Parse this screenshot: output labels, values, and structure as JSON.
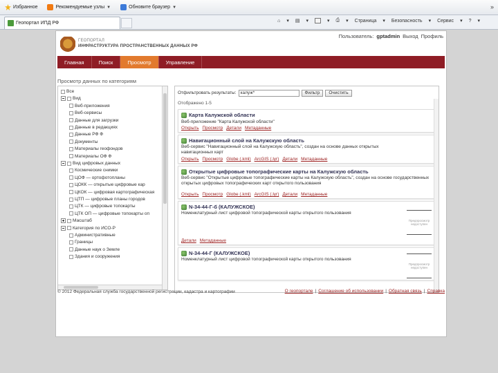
{
  "browser": {
    "bookmarks": [
      {
        "label": "Избранное",
        "icon": "star-icon"
      },
      {
        "label": "Рекомендуемые узлы",
        "icon": "suggested-sites-icon"
      },
      {
        "label": "Обновите браузер",
        "icon": "update-browser-icon"
      }
    ],
    "overflow": "»",
    "tab_title": "Геопортал ИПД РФ",
    "commands": {
      "page": "Страница",
      "safety": "Безопасность",
      "tools": "Сервис",
      "help": "?"
    }
  },
  "header": {
    "logo_line1": "ГЕОПОРТАЛ",
    "logo_line2": "ИНФРАСТРУКТУРА ПРОСТРАНСТВЕННЫХ ДАННЫХ РФ",
    "user_prefix": "Пользователь:",
    "user_name": "gptadmin",
    "logout": "Выход",
    "profile": "Профиль"
  },
  "nav": {
    "items": [
      "Главная",
      "Поиск",
      "Просмотр",
      "Управление"
    ],
    "active_index": 2
  },
  "breadcrumb": "Просмотр данных по категориям",
  "tree": [
    {
      "label": "Все",
      "level": 0,
      "toggle": "none"
    },
    {
      "label": "Вид",
      "level": 0,
      "toggle": "minus"
    },
    {
      "label": "Веб-приложения",
      "level": 1
    },
    {
      "label": "Веб-сервисы",
      "level": 1
    },
    {
      "label": "Данные для загрузки",
      "level": 1
    },
    {
      "label": "Данные в редакциях",
      "level": 1
    },
    {
      "label": "Данные РФ Ф",
      "level": 1
    },
    {
      "label": "Документы",
      "level": 1
    },
    {
      "label": "Материалы геофондов",
      "level": 1
    },
    {
      "label": "Материалы ОФ Ф",
      "level": 1
    },
    {
      "label": "Вид цифровых данных",
      "level": 0,
      "toggle": "minus"
    },
    {
      "label": "Космические снимки",
      "level": 1
    },
    {
      "label": "ЦОФ — ортофотопланы",
      "level": 1
    },
    {
      "label": "ЦОКК — открытые цифровые кар",
      "level": 1
    },
    {
      "label": "ЦКОК — цифровая картографическая",
      "level": 1
    },
    {
      "label": "ЦТП — цифровые планы городов",
      "level": 1
    },
    {
      "label": "ЦТК — цифровые топокарты",
      "level": 1
    },
    {
      "label": "ЦТК ОП — цифровые топокарты оп",
      "level": 1
    },
    {
      "label": "Масштаб",
      "level": 0,
      "toggle": "plus"
    },
    {
      "label": "Категория по ИСО-Р",
      "level": 0,
      "toggle": "minus"
    },
    {
      "label": "Административные",
      "level": 1
    },
    {
      "label": "Границы",
      "level": 1
    },
    {
      "label": "Данные наук о Земле",
      "level": 1
    },
    {
      "label": "Здания и сооружения",
      "level": 1
    }
  ],
  "results": {
    "filter_label": "Отфильтровать результаты:",
    "filter_value": "калуж*",
    "filter_button": "Фильтр",
    "clear_button": "Очистить",
    "shown": "Отображено 1-5",
    "items": [
      {
        "title": "Карта Калужской области",
        "desc": "Веб-приложение \"Карта Калужской области\"",
        "links": [
          "Открыть",
          "Просмотр",
          "Детали",
          "Метаданные"
        ]
      },
      {
        "title": "Навигационный слой на Калужскую область",
        "desc": "Веб-сервис \"Навигационный слой на Калужскую область\", создан на основе данных открытых навигационных карт",
        "links": [
          "Открыть",
          "Просмотр",
          "Globe (.kml)",
          "ArcGIS (.lyr)",
          "Детали",
          "Метаданные"
        ]
      },
      {
        "title": "Открытые цифровые топографические карты на Калужскую область",
        "desc": "Веб-сервис \"Открытые цифровые топографические карты на Калужскую область\", создан на основе государственных открытых цифровых топографических карт открытого пользования",
        "links": [
          "Открыть",
          "Просмотр",
          "Globe (.kml)",
          "ArcGIS (.lyr)",
          "Детали",
          "Метаданные"
        ]
      },
      {
        "title": "N-34-44-Г-б (КАЛУЖСКОЕ)",
        "desc": "Номенклатурный лист цифровой топографической карты открытого пользования",
        "links": [
          "Детали",
          "Метаданные"
        ],
        "thumb": "Предпросмотр недоступен"
      },
      {
        "title": "N-34-44-Г (КАЛУЖСКОЕ)",
        "desc": "Номенклатурный лист цифровой топографической карты открытого пользования",
        "links": [],
        "thumb": "Предпросмотр недоступен"
      }
    ]
  },
  "footer": {
    "copyright": "© 2012 Федеральная служба государственной регистрации, кадастра и картографии",
    "links": [
      "О геопортале",
      "Соглашение об использовании",
      "Обратная связь",
      "Справка"
    ]
  },
  "colors": {
    "nav_bg": "#8f1d25",
    "nav_active": "#e27a2e",
    "link": "#9b1f1f",
    "page_bg": "#d4d4d4"
  }
}
